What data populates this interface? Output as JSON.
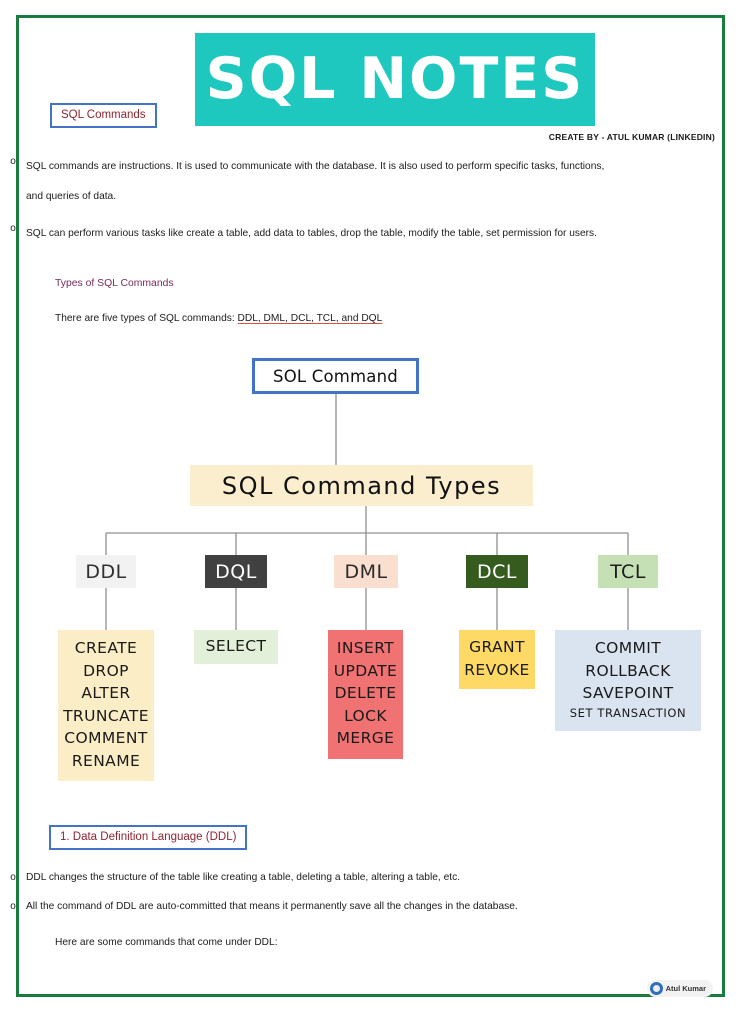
{
  "header": {
    "title": "SQL NOTES",
    "credit": "CREATE BY - ATUL KUMAR (LINKEDIN)",
    "banner_color": "#1ec8be"
  },
  "badges": {
    "sql_commands": "SQL Commands",
    "ddl_section": "1. Data Definition Language (DDL)",
    "border_color": "#4472c4",
    "text_color": "#8e2430"
  },
  "intro_bullets": [
    "SQL commands are instructions. It is used to communicate with the database. It is also used to perform specific tasks, functions, and queries of data.",
    "SQL can perform various tasks like create a table, add data to tables, drop the table, modify the table, set permission for users."
  ],
  "types_section": {
    "heading": "Types of SQL Commands",
    "heading_color": "#7b2a58",
    "lead_prefix": "There are five types of SQL commands: ",
    "lead_highlight": "DDL, DML, DCL, TCL, and DQL"
  },
  "diagram": {
    "root": "SOL Command",
    "types_box": "SQL  Command  Types",
    "categories": [
      {
        "label": "DDL",
        "bg": "#f2f2f2",
        "fg": "#303030",
        "commands": [
          "CREATE",
          "DROP",
          "ALTER",
          "TRUNCATE",
          "COMMENT",
          "RENAME"
        ],
        "leaf_bg": "#fbedc5"
      },
      {
        "label": "DQL",
        "bg": "#404040",
        "fg": "#ffffff",
        "commands": [
          "SELECT"
        ],
        "leaf_bg": "#e2efd9"
      },
      {
        "label": "DML",
        "bg": "#fadfd0",
        "fg": "#2b2b2b",
        "commands": [
          "INSERT",
          "UPDATE",
          "DELETE",
          "LOCK",
          "MERGE"
        ],
        "leaf_bg": "#f07272"
      },
      {
        "label": "DCL",
        "bg": "#355b1e",
        "fg": "#ffffff",
        "commands": [
          "GRANT",
          "REVOKE"
        ],
        "leaf_bg": "#ffd966"
      },
      {
        "label": "TCL",
        "bg": "#c5e0b4",
        "fg": "#1e1e1e",
        "commands": [
          "COMMIT",
          "ROLLBACK",
          "SAVEPOINT"
        ],
        "commands_small": [
          "SET TRANSACTION"
        ],
        "leaf_bg": "#dae3f0"
      }
    ]
  },
  "ddl_section": {
    "bullets": [
      "DDL changes the structure of the table like creating a table, deleting a table, altering a table, etc.",
      "All the command of DDL are auto-committed that means it permanently save all the changes in the database."
    ],
    "closing_line": "Here are some commands that come under DDL:"
  },
  "footer": {
    "logo_text": "Atul Kumar"
  },
  "page": {
    "border_color": "#1a7b3f"
  }
}
